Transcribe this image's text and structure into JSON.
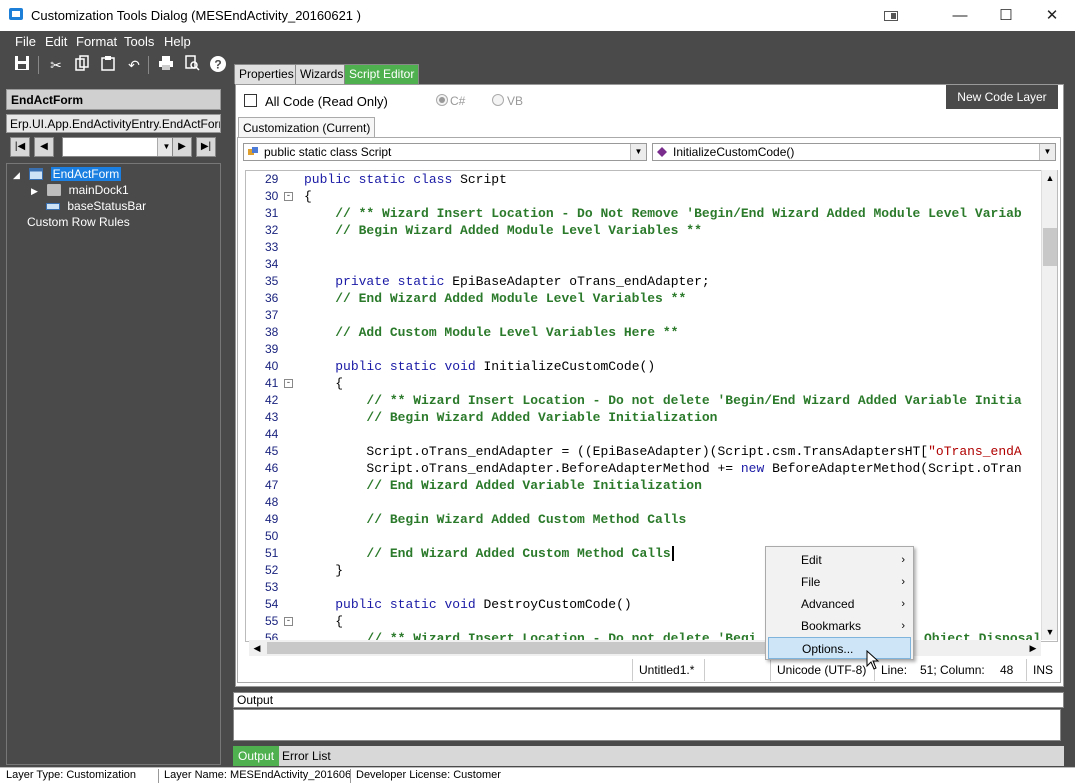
{
  "window": {
    "title": "Customization Tools Dialog  (MESEndActivity_20160621 )",
    "controls": {
      "minimize": "—",
      "maximize": "☐",
      "close": "✕",
      "restore_icon": "restore-down-icon"
    }
  },
  "menubar": {
    "items": [
      "File",
      "Edit",
      "Format",
      "Tools",
      "Help"
    ]
  },
  "toolbar": {
    "icons": [
      "save-icon",
      "cut-icon",
      "copy-icon",
      "paste-icon",
      "undo-icon",
      "print-icon",
      "print-preview-icon",
      "help-icon"
    ]
  },
  "left": {
    "form_title": "EndActForm",
    "form_class": "Erp.UI.App.EndActivityEntry.EndActForm",
    "nav_combo_value": "",
    "tree": [
      {
        "label": "EndActForm",
        "selected": true
      },
      {
        "label": "mainDock1",
        "selected": false
      },
      {
        "label": "baseStatusBar",
        "selected": false
      },
      {
        "label": "Custom Row Rules",
        "selected": false
      }
    ]
  },
  "main_tabs": [
    {
      "label": "Properties",
      "active": false
    },
    {
      "label": "Wizards",
      "active": false
    },
    {
      "label": "Script Editor",
      "active": true
    }
  ],
  "script_editor": {
    "all_code_label": "All Code (Read Only)",
    "all_code_checked": false,
    "radio_cs": "C#",
    "radio_vb": "VB",
    "new_code_layer": "New Code Layer",
    "sub_tab": "Customization (Current)",
    "class_dropdown": "public static class Script",
    "method_dropdown": "InitializeCustomCode()",
    "lines": [
      {
        "num": "29",
        "fold": "",
        "text": "public static class Script",
        "type": "kwline"
      },
      {
        "num": "30",
        "fold": "-",
        "text": "{",
        "type": "plain"
      },
      {
        "num": "31",
        "fold": "",
        "text": "    // ** Wizard Insert Location - Do Not Remove 'Begin/End Wizard Added Module Level Variab",
        "type": "comment"
      },
      {
        "num": "32",
        "fold": "",
        "text": "    // Begin Wizard Added Module Level Variables **",
        "type": "comment"
      },
      {
        "num": "33",
        "fold": "",
        "text": "",
        "type": "plain"
      },
      {
        "num": "34",
        "fold": "",
        "text": "",
        "type": "plain"
      },
      {
        "num": "35",
        "fold": "",
        "text": "    private static EpiBaseAdapter oTrans_endAdapter;",
        "type": "kwline"
      },
      {
        "num": "36",
        "fold": "",
        "text": "    // End Wizard Added Module Level Variables **",
        "type": "comment"
      },
      {
        "num": "37",
        "fold": "",
        "text": "",
        "type": "plain"
      },
      {
        "num": "38",
        "fold": "",
        "text": "    // Add Custom Module Level Variables Here **",
        "type": "comment"
      },
      {
        "num": "39",
        "fold": "",
        "text": "",
        "type": "plain"
      },
      {
        "num": "40",
        "fold": "",
        "text": "    public static void InitializeCustomCode()",
        "type": "kwline"
      },
      {
        "num": "41",
        "fold": "-",
        "text": "    {",
        "type": "plain"
      },
      {
        "num": "42",
        "fold": "",
        "text": "        // ** Wizard Insert Location - Do not delete 'Begin/End Wizard Added Variable Initia",
        "type": "comment"
      },
      {
        "num": "43",
        "fold": "",
        "text": "        // Begin Wizard Added Variable Initialization",
        "type": "comment"
      },
      {
        "num": "44",
        "fold": "",
        "text": "",
        "type": "plain"
      },
      {
        "num": "45",
        "fold": "",
        "text": "        Script.oTrans_endAdapter = ((EpiBaseAdapter)(Script.csm.TransAdaptersHT[\"oTrans_endA",
        "type": "stringline"
      },
      {
        "num": "46",
        "fold": "",
        "text": "        Script.oTrans_endAdapter.BeforeAdapterMethod += new BeforeAdapterMethod(Script.oTran",
        "type": "kwline"
      },
      {
        "num": "47",
        "fold": "",
        "text": "        // End Wizard Added Variable Initialization",
        "type": "comment"
      },
      {
        "num": "48",
        "fold": "",
        "text": "",
        "type": "plain"
      },
      {
        "num": "49",
        "fold": "",
        "text": "        // Begin Wizard Added Custom Method Calls",
        "type": "comment"
      },
      {
        "num": "50",
        "fold": "",
        "text": "",
        "type": "plain"
      },
      {
        "num": "51",
        "fold": "",
        "text": "        // End Wizard Added Custom Method Calls",
        "type": "comment"
      },
      {
        "num": "52",
        "fold": "",
        "text": "    }",
        "type": "plain"
      },
      {
        "num": "53",
        "fold": "",
        "text": "",
        "type": "plain"
      },
      {
        "num": "54",
        "fold": "",
        "text": "    public static void DestroyCustomCode()",
        "type": "kwline"
      },
      {
        "num": "55",
        "fold": "-",
        "text": "    {",
        "type": "plain"
      },
      {
        "num": "56",
        "fold": "",
        "text": "        // ** Wizard Insert Location - Do not delete 'Begi",
        "type": "comment"
      }
    ],
    "line56_tail": "Object Disposal",
    "status": {
      "filename": "Untitled1.*",
      "encoding": "Unicode (UTF-8)",
      "line_label": "Line:",
      "line_value": "51; Column:",
      "column_value": "48",
      "mode": "INS"
    }
  },
  "context_menu": {
    "items": [
      {
        "label": "Edit",
        "submenu": true,
        "hover": false
      },
      {
        "label": "File",
        "submenu": true,
        "hover": false
      },
      {
        "label": "Advanced",
        "submenu": true,
        "hover": false
      },
      {
        "label": "Bookmarks",
        "submenu": true,
        "hover": false
      },
      {
        "label": "Options...",
        "submenu": false,
        "hover": true
      }
    ],
    "submenu_glyph": "›"
  },
  "output": {
    "header": "Output",
    "tabs": [
      {
        "label": "Output",
        "active": true
      },
      {
        "label": "Error List",
        "active": false
      }
    ]
  },
  "statusbar": {
    "layer_type": "Layer Type:  Customization",
    "layer_name": "Layer Name:  MESEndActivity_201606",
    "license": "Developer License:  Customer"
  },
  "colors": {
    "accent_green": "#4eb04e",
    "selection_blue": "#1a7fe0",
    "chrome_dark": "#4a4a4a",
    "comment_green": "#2b7a2b",
    "keyword_blue": "#1a1aa6"
  }
}
